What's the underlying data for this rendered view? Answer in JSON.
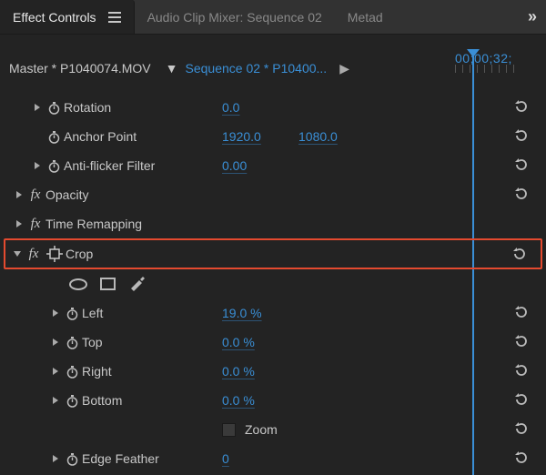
{
  "tabs": {
    "active": "Effect Controls",
    "second": "Audio Clip Mixer: Sequence 02",
    "third": "Metad"
  },
  "header": {
    "master": "Master * P1040074.MOV",
    "dropdown_glyph": "▼",
    "sequence": "Sequence 02 * P10400...",
    "play_glyph": "▶",
    "timecode": "00;00;32;"
  },
  "effects": {
    "rotation": {
      "name": "Rotation",
      "value": "0.0"
    },
    "anchor": {
      "name": "Anchor Point",
      "x": "1920.0",
      "y": "1080.0"
    },
    "antiflicker": {
      "name": "Anti-flicker Filter",
      "value": "0.00"
    },
    "opacity": {
      "name": "Opacity"
    },
    "time_remap": {
      "name": "Time Remapping"
    },
    "crop": {
      "name": "Crop",
      "left": {
        "name": "Left",
        "value": "19.0 %"
      },
      "top": {
        "name": "Top",
        "value": "0.0 %"
      },
      "right": {
        "name": "Right",
        "value": "0.0 %"
      },
      "bottom": {
        "name": "Bottom",
        "value": "0.0 %"
      },
      "zoom": {
        "name": "Zoom"
      },
      "edge_feather": {
        "name": "Edge Feather",
        "value": "0"
      }
    }
  },
  "icons": {
    "fx": "fx"
  }
}
